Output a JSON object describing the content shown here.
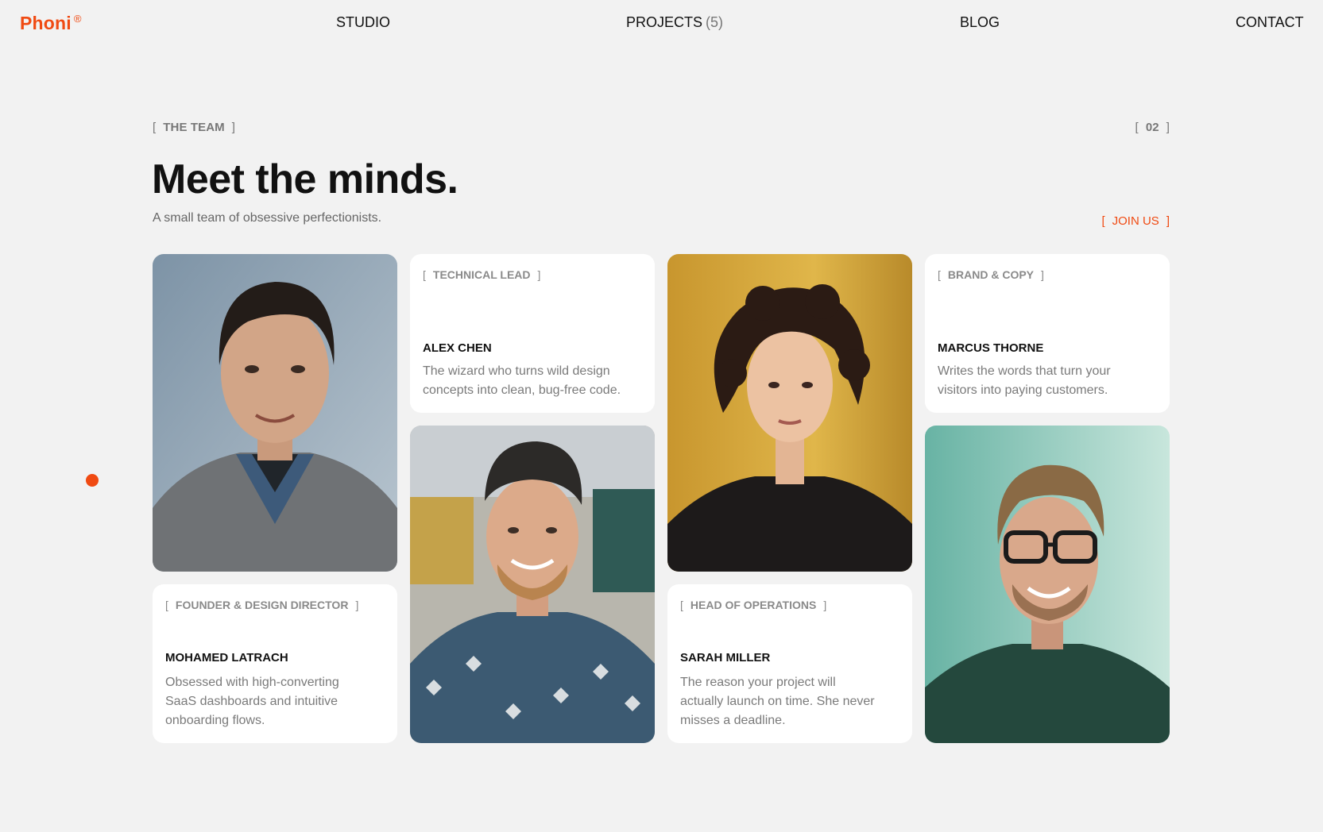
{
  "nav": {
    "logo": "Phoni",
    "logo_mark": "®",
    "studio": "STUDIO",
    "projects": "PROJECTS",
    "projects_count": "(5)",
    "blog": "BLOG",
    "contact": "CONTACT"
  },
  "section": {
    "tag": "THE TEAM",
    "index": "02",
    "title": "Meet the minds.",
    "subtitle": "A small team of obsessive perfectionists.",
    "join_label": "JOIN US"
  },
  "team": [
    {
      "role": "FOUNDER & DESIGN DIRECTOR",
      "name": "MOHAMED LATRACH",
      "bio": "Obsessed with high-converting SaaS dashboards and intuitive onboarding flows.",
      "photo": "portrait-man-gray-sweater"
    },
    {
      "role": "TECHNICAL LEAD",
      "name": "ALEX CHEN",
      "bio": "The wizard who turns wild design concepts into clean, bug-free code.",
      "photo": "portrait-man-backwards-cap"
    },
    {
      "role": "HEAD OF OPERATIONS",
      "name": "SARAH MILLER",
      "bio": "The reason your project will actually launch on time. She never misses a deadline.",
      "photo": "portrait-woman-curly-hair"
    },
    {
      "role": "BRAND & COPY",
      "name": "MARCUS THORNE",
      "bio": "Writes the words that turn your visitors into paying customers.",
      "photo": "portrait-man-glasses"
    }
  ],
  "colors": {
    "accent": "#f04a12",
    "background": "#f2f2f2",
    "card": "#ffffff",
    "text": "#111111",
    "muted": "#7a7a7a"
  }
}
